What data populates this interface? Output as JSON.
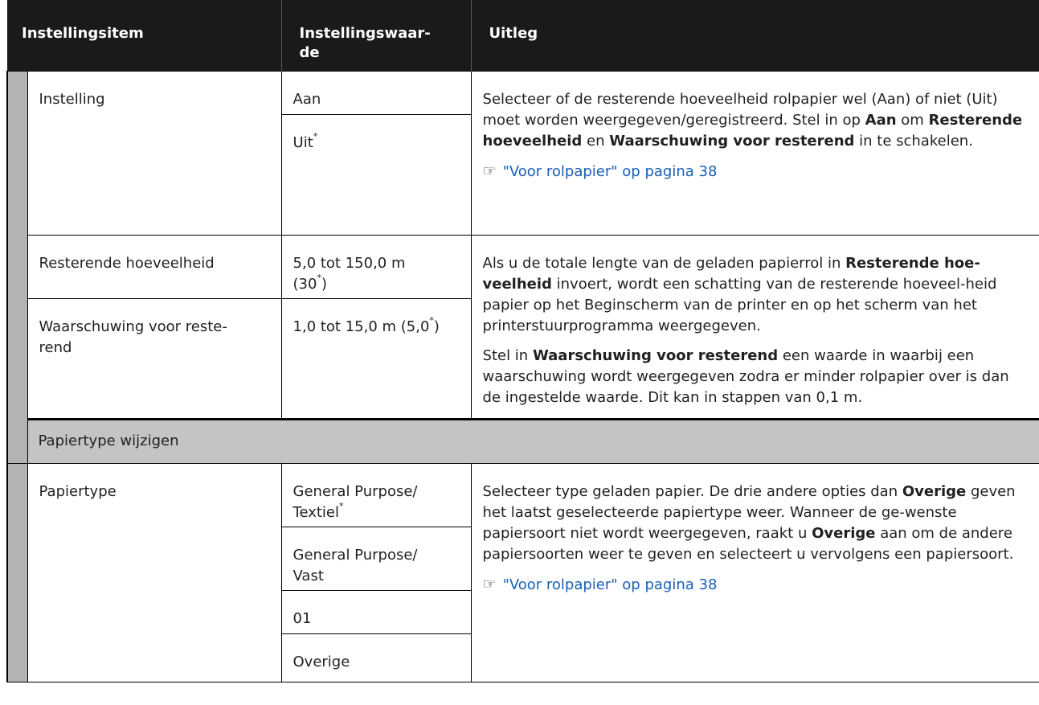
{
  "header": {
    "col_item": "Instellingsitem",
    "col_value": "Instellingswaar-de",
    "col_value_line1": "Instellingswaar-",
    "col_value_line2": "de",
    "col_desc": "Uitleg"
  },
  "group1": {
    "instelling": {
      "label": "Instelling",
      "values": [
        "Aan",
        "Uit"
      ],
      "default_mark": "*",
      "desc_part1": "Selecteer of de resterende hoeveelheid rolpapier wel (Aan) of niet (Uit) moet worden weergegeven/geregistreerd. Stel in op ",
      "desc_bold1": "Aan",
      "desc_part2": " om ",
      "desc_bold2": "Resterende hoeveelheid",
      "desc_part3": " en ",
      "desc_bold3": "Waarschuwing voor resterend",
      "desc_part4": " in te schakelen.",
      "link_icon": "pointing-hand-icon",
      "link_text": "\"Voor rolpapier\" op pagina 38"
    },
    "resterende": {
      "label": "Resterende hoeveelheid",
      "value_part1": "5,0 tot 150,0 m",
      "value_part2": "(30",
      "value_part3": ")",
      "default_mark": "*"
    },
    "waarschuwing": {
      "label": "Waarschuwing voor reste-rend",
      "label_line1": "Waarschuwing voor reste-",
      "label_line2": "rend",
      "value_part1": "1,0 tot 15,0 m (5,0",
      "value_part2": ")",
      "default_mark": "*"
    },
    "desc_shared_part1": "Als u de totale lengte van de geladen papierrol in ",
    "desc_shared_bold1": "Resterende hoe-veelheid",
    "desc_shared_part2": " invoert, wordt een schatting van de resterende hoeveel-heid papier op het Beginscherm van de printer en op het scherm van het printerstuurprogramma weergegeven.",
    "desc_shared2_part1": "Stel in ",
    "desc_shared2_bold1": "Waarschuwing voor resterend",
    "desc_shared2_part2": " een waarde in waarbij een waarschuwing wordt weergegeven zodra er minder rolpapier over is dan de ingestelde waarde. Dit kan in stappen van 0,1 m."
  },
  "section2": {
    "title": "Papiertype wijzigen"
  },
  "papiertype": {
    "label": "Papiertype",
    "options": [
      "General Purpose/ Textiel",
      "General Purpose/ Vast",
      "01",
      "Overige"
    ],
    "opt1_line1": "General Purpose/",
    "opt1_line2": "Textiel",
    "opt2_line1": "General Purpose/",
    "opt2_line2": "Vast",
    "opt3": "01",
    "opt4": "Overige",
    "default_mark": "*",
    "desc_part1": "Selecteer type geladen papier. De drie andere opties dan ",
    "desc_bold1": "Overige",
    "desc_part2": " geven het laatst geselecteerde papiertype weer. Wanneer de ge-wenste papiersoort niet wordt weergegeven, raakt u ",
    "desc_bold2": "Overige",
    "desc_part3": " aan om de andere papiersoorten weer te geven en selecteert u vervolgens een papiersoort.",
    "link_icon": "pointing-hand-icon",
    "link_text": "\"Voor rolpapier\" op pagina 38"
  }
}
